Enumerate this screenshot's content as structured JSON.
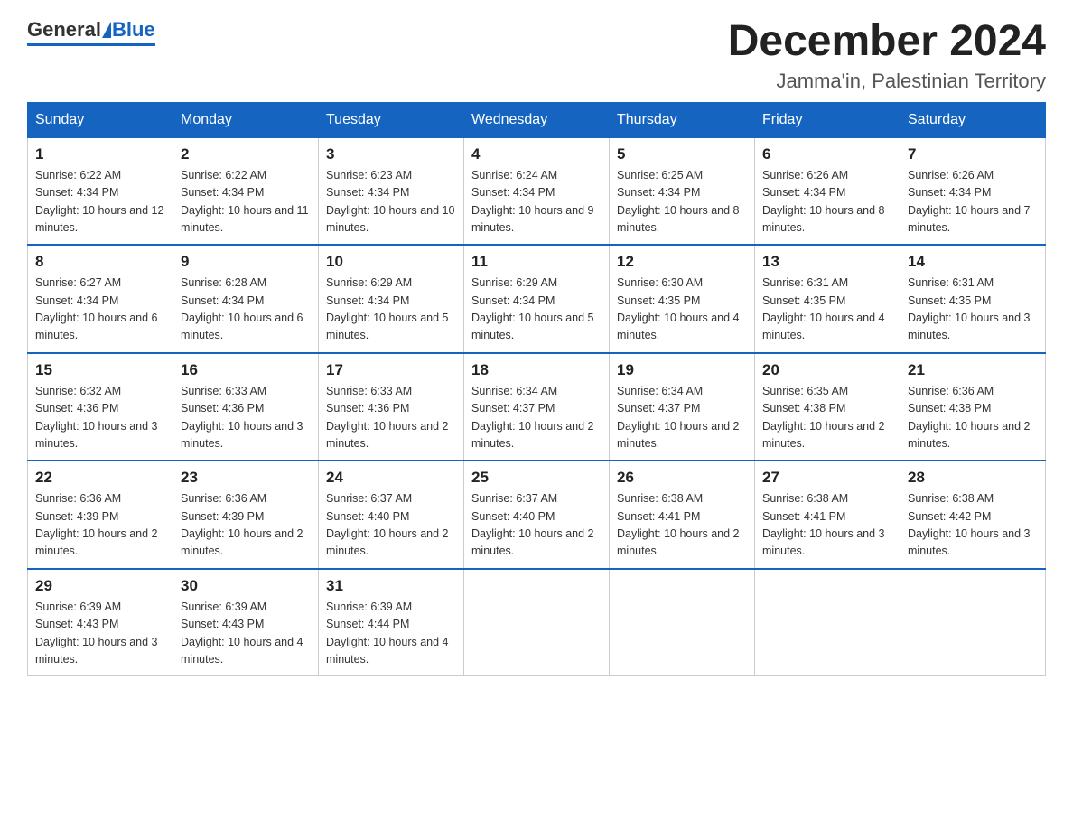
{
  "header": {
    "logo": {
      "general": "General",
      "blue": "Blue"
    },
    "title": "December 2024",
    "subtitle": "Jamma'in, Palestinian Territory"
  },
  "calendar": {
    "days_of_week": [
      "Sunday",
      "Monday",
      "Tuesday",
      "Wednesday",
      "Thursday",
      "Friday",
      "Saturday"
    ],
    "weeks": [
      [
        {
          "day": "1",
          "sunrise": "6:22 AM",
          "sunset": "4:34 PM",
          "daylight": "10 hours and 12 minutes."
        },
        {
          "day": "2",
          "sunrise": "6:22 AM",
          "sunset": "4:34 PM",
          "daylight": "10 hours and 11 minutes."
        },
        {
          "day": "3",
          "sunrise": "6:23 AM",
          "sunset": "4:34 PM",
          "daylight": "10 hours and 10 minutes."
        },
        {
          "day": "4",
          "sunrise": "6:24 AM",
          "sunset": "4:34 PM",
          "daylight": "10 hours and 9 minutes."
        },
        {
          "day": "5",
          "sunrise": "6:25 AM",
          "sunset": "4:34 PM",
          "daylight": "10 hours and 8 minutes."
        },
        {
          "day": "6",
          "sunrise": "6:26 AM",
          "sunset": "4:34 PM",
          "daylight": "10 hours and 8 minutes."
        },
        {
          "day": "7",
          "sunrise": "6:26 AM",
          "sunset": "4:34 PM",
          "daylight": "10 hours and 7 minutes."
        }
      ],
      [
        {
          "day": "8",
          "sunrise": "6:27 AM",
          "sunset": "4:34 PM",
          "daylight": "10 hours and 6 minutes."
        },
        {
          "day": "9",
          "sunrise": "6:28 AM",
          "sunset": "4:34 PM",
          "daylight": "10 hours and 6 minutes."
        },
        {
          "day": "10",
          "sunrise": "6:29 AM",
          "sunset": "4:34 PM",
          "daylight": "10 hours and 5 minutes."
        },
        {
          "day": "11",
          "sunrise": "6:29 AM",
          "sunset": "4:34 PM",
          "daylight": "10 hours and 5 minutes."
        },
        {
          "day": "12",
          "sunrise": "6:30 AM",
          "sunset": "4:35 PM",
          "daylight": "10 hours and 4 minutes."
        },
        {
          "day": "13",
          "sunrise": "6:31 AM",
          "sunset": "4:35 PM",
          "daylight": "10 hours and 4 minutes."
        },
        {
          "day": "14",
          "sunrise": "6:31 AM",
          "sunset": "4:35 PM",
          "daylight": "10 hours and 3 minutes."
        }
      ],
      [
        {
          "day": "15",
          "sunrise": "6:32 AM",
          "sunset": "4:36 PM",
          "daylight": "10 hours and 3 minutes."
        },
        {
          "day": "16",
          "sunrise": "6:33 AM",
          "sunset": "4:36 PM",
          "daylight": "10 hours and 3 minutes."
        },
        {
          "day": "17",
          "sunrise": "6:33 AM",
          "sunset": "4:36 PM",
          "daylight": "10 hours and 2 minutes."
        },
        {
          "day": "18",
          "sunrise": "6:34 AM",
          "sunset": "4:37 PM",
          "daylight": "10 hours and 2 minutes."
        },
        {
          "day": "19",
          "sunrise": "6:34 AM",
          "sunset": "4:37 PM",
          "daylight": "10 hours and 2 minutes."
        },
        {
          "day": "20",
          "sunrise": "6:35 AM",
          "sunset": "4:38 PM",
          "daylight": "10 hours and 2 minutes."
        },
        {
          "day": "21",
          "sunrise": "6:36 AM",
          "sunset": "4:38 PM",
          "daylight": "10 hours and 2 minutes."
        }
      ],
      [
        {
          "day": "22",
          "sunrise": "6:36 AM",
          "sunset": "4:39 PM",
          "daylight": "10 hours and 2 minutes."
        },
        {
          "day": "23",
          "sunrise": "6:36 AM",
          "sunset": "4:39 PM",
          "daylight": "10 hours and 2 minutes."
        },
        {
          "day": "24",
          "sunrise": "6:37 AM",
          "sunset": "4:40 PM",
          "daylight": "10 hours and 2 minutes."
        },
        {
          "day": "25",
          "sunrise": "6:37 AM",
          "sunset": "4:40 PM",
          "daylight": "10 hours and 2 minutes."
        },
        {
          "day": "26",
          "sunrise": "6:38 AM",
          "sunset": "4:41 PM",
          "daylight": "10 hours and 2 minutes."
        },
        {
          "day": "27",
          "sunrise": "6:38 AM",
          "sunset": "4:41 PM",
          "daylight": "10 hours and 3 minutes."
        },
        {
          "day": "28",
          "sunrise": "6:38 AM",
          "sunset": "4:42 PM",
          "daylight": "10 hours and 3 minutes."
        }
      ],
      [
        {
          "day": "29",
          "sunrise": "6:39 AM",
          "sunset": "4:43 PM",
          "daylight": "10 hours and 3 minutes."
        },
        {
          "day": "30",
          "sunrise": "6:39 AM",
          "sunset": "4:43 PM",
          "daylight": "10 hours and 4 minutes."
        },
        {
          "day": "31",
          "sunrise": "6:39 AM",
          "sunset": "4:44 PM",
          "daylight": "10 hours and 4 minutes."
        },
        null,
        null,
        null,
        null
      ]
    ]
  }
}
